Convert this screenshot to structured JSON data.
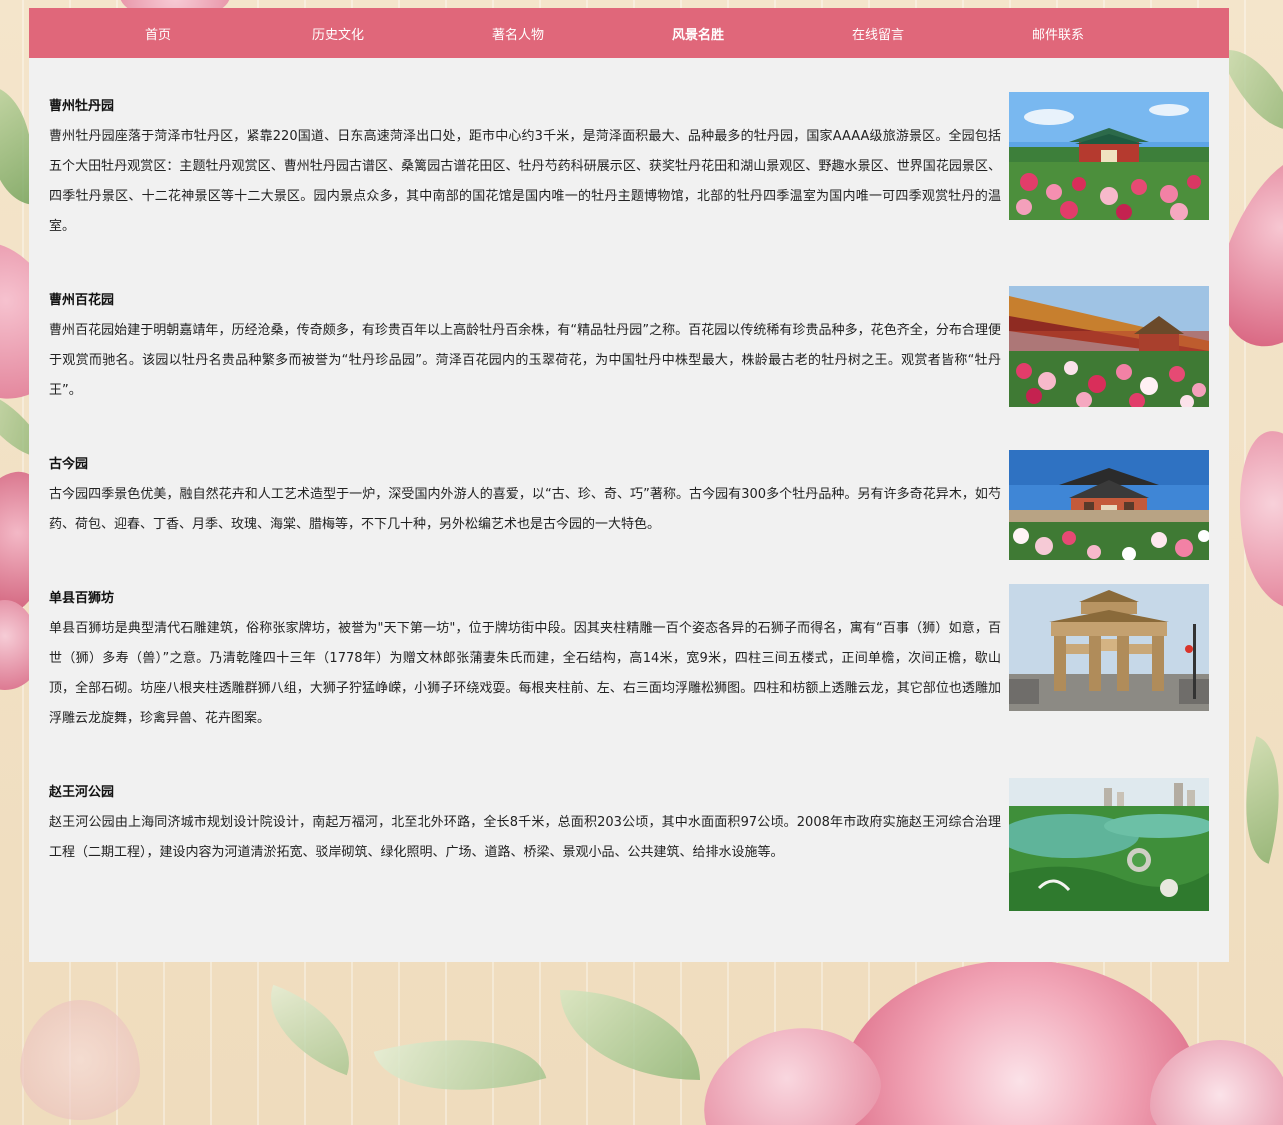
{
  "nav": {
    "items": [
      {
        "label": "首页"
      },
      {
        "label": "历史文化"
      },
      {
        "label": "著名人物"
      },
      {
        "label": "风景名胜",
        "active": true
      },
      {
        "label": "在线留言"
      },
      {
        "label": "邮件联系"
      }
    ],
    "bg_color": "#e0677a"
  },
  "spots": [
    {
      "title": "曹州牡丹园",
      "desc": "曹州牡丹园座落于菏泽市牡丹区，紧靠220国道、日东高速菏泽出口处，距市中心约3千米，是菏泽面积最大、品种最多的牡丹园，国家AAAA级旅游景区。全园包括五个大田牡丹观赏区：主题牡丹观赏区、曹州牡丹园古谱区、桑篱园古谱花田区、牡丹芍药科研展示区、获奖牡丹花田和湖山景观区、野趣水景区、世界国花园景区、四季牡丹景区、十二花神景区等十二大景区。园内景点众多，其中南部的国花馆是国内唯一的牡丹主题博物馆，北部的牡丹四季温室为国内唯一可四季观赏牡丹的温室。",
      "image": "peony-garden-gate-photo"
    },
    {
      "title": "曹州百花园",
      "desc": "曹州百花园始建于明朝嘉靖年，历经沧桑，传奇颇多，有珍贵百年以上高龄牡丹百余株，有“精品牡丹园”之称。百花园以传统稀有珍贵品种多，花色齐全，分布合理便于观赏而驰名。该园以牡丹名贵品种繁多而被誉为“牡丹珍品园”。菏泽百花园内的玉翠荷花，为中国牡丹中株型最大，株龄最古老的牡丹树之王。观赏者皆称“牡丹王”。",
      "image": "hundred-flower-garden-corridor-photo"
    },
    {
      "title": "古今园",
      "desc": "古今园四季景色优美，融自然花卉和人工艺术造型于一炉，深受国内外游人的喜爱，以“古、珍、奇、巧”著称。古今园有300多个牡丹品种。另有许多奇花异木，如芍药、荷包、迎春、丁香、月季、玫瑰、海棠、腊梅等，不下几十种，另外松编艺术也是古今园的一大特色。",
      "image": "gujin-garden-gate-photo"
    },
    {
      "title": "单县百狮坊",
      "desc": "单县百狮坊是典型清代石雕建筑，俗称张家牌坊，被誉为\"天下第一坊\"，位于牌坊街中段。因其夹柱精雕一百个姿态各异的石狮子而得名，寓有“百事（狮）如意，百世（狮）多寿（兽）”之意。乃清乾隆四十三年（1778年）为赠文林郎张蒲妻朱氏而建，全石结构，高14米，宽9米，四柱三间五楼式，正间单檐，次间正檐，歇山顶，全部石砌。坊座八根夹柱透雕群狮八组，大狮子狞猛峥嵘，小狮子环绕戏耍。每根夹柱前、左、右三面均浮雕松狮图。四柱和枋额上透雕云龙，其它部位也透雕加浮雕云龙旋舞，珍禽异兽、花卉图案。",
      "image": "stone-archway-photo"
    },
    {
      "title": "赵王河公园",
      "desc": "赵王河公园由上海同济城市规划设计院设计，南起万福河，北至北外环路，全长8千米，总面积203公顷，其中水面面积97公顷。2008年市政府实施赵王河综合治理工程（二期工程），建设内容为河道清淤拓宽、驳岸砌筑、绿化照明、广场、道路、桥梁、景观小品、公共建筑、给排水设施等。",
      "image": "river-park-aerial-photo"
    }
  ]
}
